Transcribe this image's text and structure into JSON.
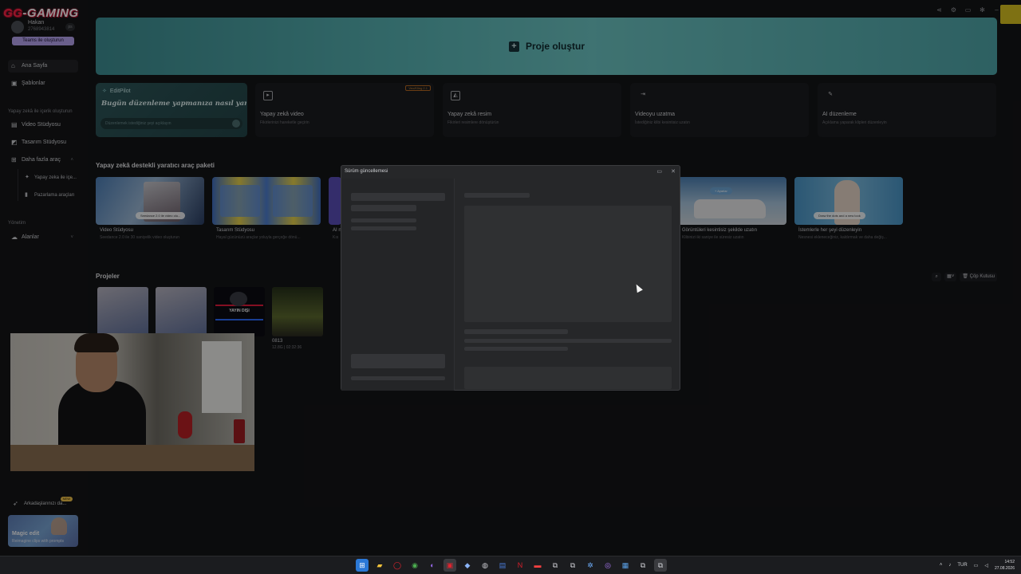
{
  "brand": {
    "prefix": "GG",
    "name": "GAMING"
  },
  "user": {
    "name": "Hakan",
    "id": "2768943814",
    "badge": "ps"
  },
  "teams_button": "Teams ile oluşturun",
  "nav": {
    "home": "Ana Sayfa",
    "templates": "Şablonlar",
    "ai_section": "Yapay zekâ ile içerik oluşturun",
    "video_studio": "Video Stüdyosu",
    "design_studio": "Tasarım Stüdyosu",
    "more_tools": "Daha fazla araç",
    "sub_ai": "Yapay zeka ile içe...",
    "sub_marketing": "Pazarlama araçları",
    "manage_section": "Yönetim",
    "spaces": "Alanlar"
  },
  "invite": {
    "label": "Arkadaşlarınızı da...",
    "badge": "NEW"
  },
  "magic_card": {
    "title": "Magic edit",
    "desc": "Reimagine clips with prompts"
  },
  "hero": {
    "label": "Proje oluştur"
  },
  "editpilot": {
    "title": "EditPilot",
    "heading": "Bugün düzenleme yapmanıza nasıl yardım",
    "placeholder": "Düzenlemek istediğiniz şeyi açıklayın"
  },
  "tools": [
    {
      "title": "Yapay zekâ video",
      "desc": "Fikirlerinizi hareketle geçirin",
      "badge": "Veo/Kling 2.1",
      "icon": "video-icon"
    },
    {
      "title": "Yapay zekâ resim",
      "desc": "Fikirleri resimlere dönüştürün",
      "icon": "image-icon"
    },
    {
      "title": "Videoyu uzatma",
      "desc": "İstediğiniz klibi kesintisiz uzatın",
      "icon": "extend-icon"
    },
    {
      "title": "AI düzenleme",
      "desc": "Açıklama yaparak klipleri düzenleyin",
      "icon": "wand-icon"
    }
  ],
  "kit_section": "Yapay zekâ destekli yaratıcı araç paketi",
  "kits": [
    {
      "title": "Video Stüdyosu",
      "desc": "Seedance 2.0 ile 30 saniyelik video oluşturun",
      "pill": "Seedance 2.0 ile video olu..."
    },
    {
      "title": "Tasarım Stüdyosu",
      "desc": "Hayal gücünüzü araçlar yoluyla gerçeğe dönü..."
    },
    {
      "title": "AI n",
      "desc": "Kıs"
    },
    {
      "title": "Görüntüleri kesintisiz şekilde uzatın",
      "desc": "Klibinizi iki saniye ile süresiz uzatın",
      "pill": "+ Ayarlar"
    },
    {
      "title": "İstemlerle her şeyi düzenleyin",
      "desc": "Nesnesi ekleneceğiniz, kaldırmak ve daha değiş...",
      "pill": "Draw the dots and a new look"
    }
  ],
  "projects_section": "Projeler",
  "projects": [
    {
      "label": "",
      "meta": ""
    },
    {
      "label": "",
      "meta": ""
    },
    {
      "label": "",
      "meta": "",
      "overlay_text": "YAYIN DIŞI"
    },
    {
      "label": "0813",
      "meta": "12.8G | 02:32:36"
    }
  ],
  "project_tools": {
    "trash": "Çöp Kutusu"
  },
  "dialog": {
    "title": "Sürüm güncellemesi"
  },
  "taskbar": {
    "lang": "TUR",
    "time": "14:52",
    "date": "27.08.2026"
  },
  "colors": {
    "hero": "#59b5b5",
    "accent": "#b7a4ef",
    "background": "#141517"
  }
}
